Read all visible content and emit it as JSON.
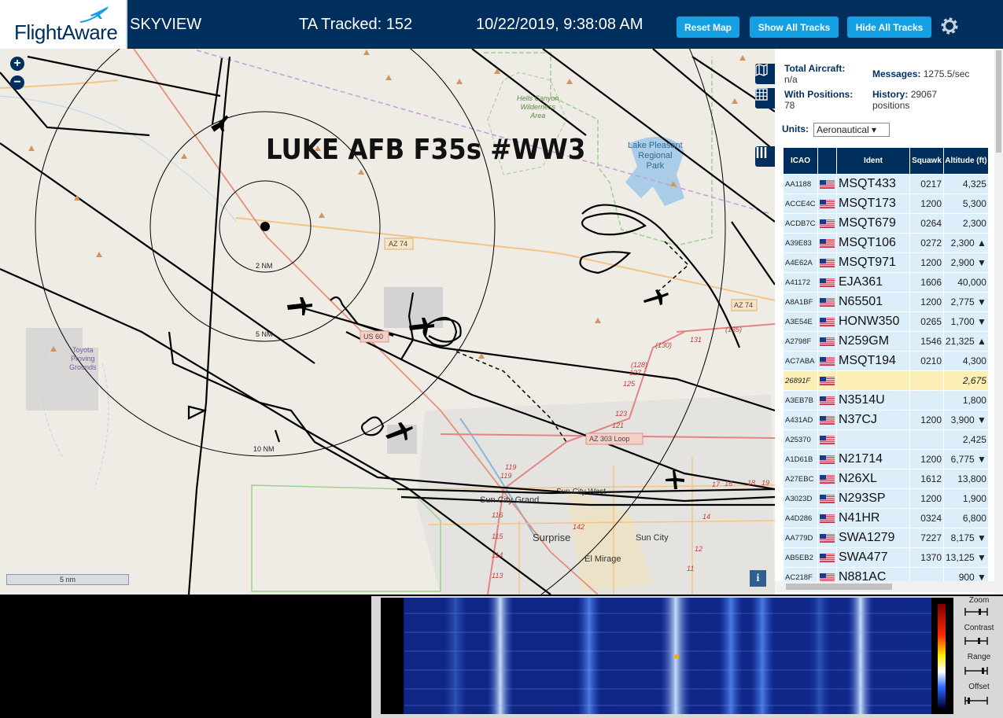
{
  "header": {
    "logo_text": "FlightAware",
    "app_name": "SKYVIEW",
    "tracked": "TA Tracked: 152",
    "datetime": "10/22/2019, 9:38:08 AM",
    "buttons": {
      "reset_map": "Reset Map",
      "show_all": "Show All Tracks",
      "hide_all": "Hide All Tracks"
    },
    "brand_color": "#002f5d",
    "button_color": "#14a0e3"
  },
  "map": {
    "overlay_title": "LUKE AFB F35s #WW3",
    "zoom_in": "+",
    "zoom_out": "−",
    "range_rings": [
      "2 NM",
      "5 NM",
      "10 NM"
    ],
    "place_labels": {
      "hells_canyon": "Hells Canyon\nWilderness\nArea",
      "lake_pleasant": "Lake Pleasant\nRegional\nPark",
      "toyota": "Toyota\nProving\nGrounds",
      "sun_city_grand": "Sun City Grand",
      "sun_city_west": "Sun City West",
      "surprise": "Surprise",
      "sun_city": "Sun City",
      "el_mirage": "El Mirage"
    },
    "road_labels": [
      "AZ 74",
      "AZ 74",
      "US 60",
      "AZ 303 Loop"
    ],
    "route_numbers": [
      "(130)",
      "131",
      "(135)",
      "(128)",
      "127",
      "125",
      "123",
      "121",
      "119",
      "119",
      "116",
      "115",
      "114",
      "113",
      "142",
      "17",
      "16",
      "18",
      "19",
      "14",
      "12",
      "11"
    ],
    "scale_label": "5 nm",
    "info_label": "i"
  },
  "panel": {
    "total_aircraft_label": "Total Aircraft:",
    "total_aircraft_value": "n/a",
    "messages_label": "Messages:",
    "messages_value": "1275.5/sec",
    "with_positions_label": "With Positions:",
    "with_positions_value": "78",
    "history_label": "History:",
    "history_value": "29067",
    "history_unit": "positions",
    "units_label": "Units:",
    "units_value": "Aeronautical ▾",
    "columns": [
      "ICAO",
      "",
      "Ident",
      "Squawk",
      "Altitude (ft)"
    ],
    "rows": [
      {
        "icao": "AA1188",
        "ident": "MSQT433",
        "squawk": "0217",
        "alt": "4,325"
      },
      {
        "icao": "ACCE4C",
        "ident": "MSQT173",
        "squawk": "1200",
        "alt": "5,300"
      },
      {
        "icao": "ACDB7C",
        "ident": "MSQT679",
        "squawk": "0264",
        "alt": "2,300"
      },
      {
        "icao": "A39E83",
        "ident": "MSQT106",
        "squawk": "0272",
        "alt": "2,300 ▲"
      },
      {
        "icao": "A4E62A",
        "ident": "MSQT971",
        "squawk": "1200",
        "alt": "2,900 ▼"
      },
      {
        "icao": "A41172",
        "ident": "EJA361",
        "squawk": "1606",
        "alt": "40,000"
      },
      {
        "icao": "A8A1BF",
        "ident": "N65501",
        "squawk": "1200",
        "alt": "2,775 ▼"
      },
      {
        "icao": "A3E54E",
        "ident": "HONW350",
        "squawk": "0265",
        "alt": "1,700 ▼"
      },
      {
        "icao": "A2798F",
        "ident": "N259GM",
        "squawk": "1546",
        "alt": "21,325 ▲"
      },
      {
        "icao": "AC7ABA",
        "ident": "MSQT194",
        "squawk": "0210",
        "alt": "4,300"
      },
      {
        "icao": "26891F",
        "ident": "",
        "squawk": "",
        "alt": "2,675"
      },
      {
        "icao": "A3EB7B",
        "ident": "N3514U",
        "squawk": "",
        "alt": "1,800"
      },
      {
        "icao": "A431AD",
        "ident": "N37CJ",
        "squawk": "1200",
        "alt": "3,900 ▼"
      },
      {
        "icao": "A25370",
        "ident": "",
        "squawk": "",
        "alt": "2,425"
      },
      {
        "icao": "A1D61B",
        "ident": "N21714",
        "squawk": "1200",
        "alt": "6,775 ▼"
      },
      {
        "icao": "A27EBC",
        "ident": "N26XL",
        "squawk": "1612",
        "alt": "13,800"
      },
      {
        "icao": "A3023D",
        "ident": "N293SP",
        "squawk": "1200",
        "alt": "1,900"
      },
      {
        "icao": "A4D286",
        "ident": "N41HR",
        "squawk": "0324",
        "alt": "6,800"
      },
      {
        "icao": "AA779D",
        "ident": "SWA1279",
        "squawk": "7227",
        "alt": "8,175 ▼"
      },
      {
        "icao": "AB5EB2",
        "ident": "SWA477",
        "squawk": "1370",
        "alt": "13,125 ▼"
      },
      {
        "icao": "AC218F",
        "ident": "N881AC",
        "squawk": "",
        "alt": "900 ▼"
      }
    ]
  },
  "waterfall": {
    "controls": [
      "Zoom",
      "Contrast",
      "Range",
      "Offset"
    ]
  }
}
